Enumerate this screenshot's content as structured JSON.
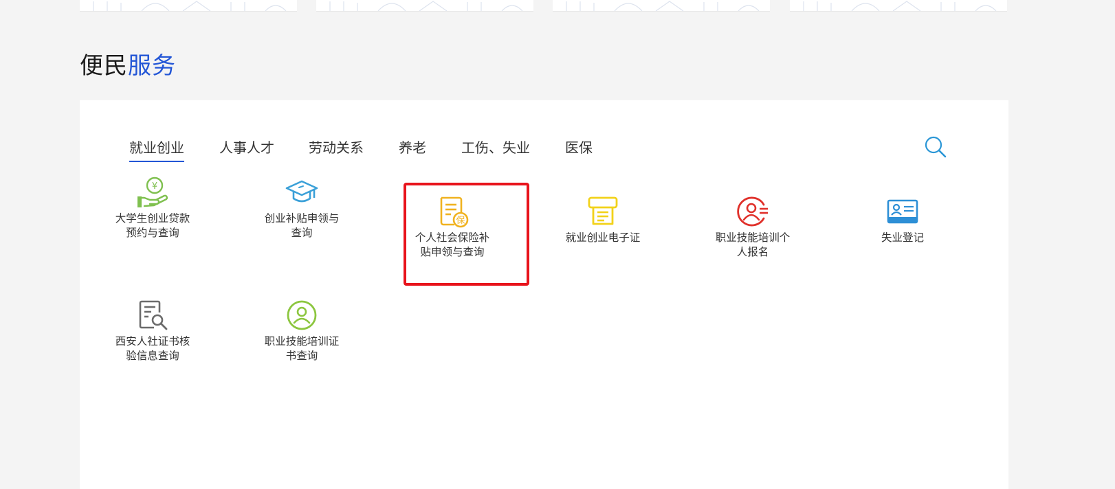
{
  "section": {
    "title_part1": "便民",
    "title_part2": "服务"
  },
  "tabs": [
    {
      "label": "就业创业",
      "active": true
    },
    {
      "label": "人事人才",
      "active": false
    },
    {
      "label": "劳动关系",
      "active": false
    },
    {
      "label": "养老",
      "active": false
    },
    {
      "label": "工伤、失业",
      "active": false
    },
    {
      "label": "医保",
      "active": false
    }
  ],
  "search": {
    "icon": "search-icon"
  },
  "services": [
    {
      "label": "大学生创业贷款预约与查询",
      "icon": "loan-hand-coin-icon",
      "color": "#7fc04f"
    },
    {
      "label": "创业补贴申领与查询",
      "icon": "graduation-cap-icon",
      "color": "#3aa0d8"
    },
    {
      "label": "个人社会保险补贴申领与查询",
      "icon": "insurance-document-icon",
      "color": "#f0b21f",
      "highlighted": true
    },
    {
      "label": "就业创业电子证",
      "icon": "electronic-certificate-icon",
      "color": "#f2d21a"
    },
    {
      "label": "职业技能培训个人报名",
      "icon": "user-signup-icon",
      "color": "#e0302a"
    },
    {
      "label": "失业登记",
      "icon": "id-card-icon",
      "color": "#2d8fd6"
    },
    {
      "label": "西安人社证书核验信息查询",
      "icon": "document-search-icon",
      "color": "#6b6b6b"
    },
    {
      "label": "职业技能培训证书查询",
      "icon": "user-circle-icon",
      "color": "#8cc63f"
    }
  ],
  "colors": {
    "accent": "#2356d6",
    "highlight_border": "#e8141c",
    "background": "#f4f4f4"
  }
}
